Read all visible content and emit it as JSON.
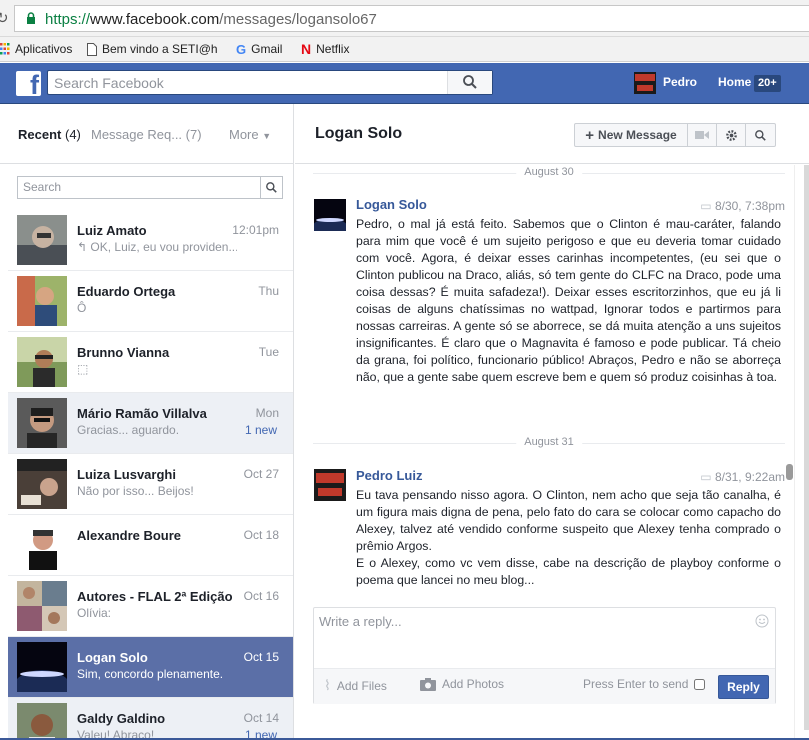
{
  "browser": {
    "url_scheme": "https://",
    "url_domain": "www.facebook.com",
    "url_path": "/messages/logansolo67",
    "bookmarks": [
      {
        "label": "Aplicativos",
        "icon": "apps-grid-icon"
      },
      {
        "label": "Bem vindo a SETI@hc",
        "icon": "page-icon"
      },
      {
        "label": "Gmail",
        "icon": "google-icon"
      },
      {
        "label": "Netflix",
        "icon": "netflix-icon"
      }
    ]
  },
  "topbar": {
    "search_placeholder": "Search Facebook",
    "user_name": "Pedro",
    "home_label": "Home",
    "home_count": "20+",
    "brand_color": "#4267b2"
  },
  "left": {
    "tab_recent": "Recent",
    "tab_recent_count": "(4)",
    "tab_requests": "Message Req...",
    "tab_requests_count": "(7)",
    "tab_more": "More",
    "search_placeholder": "Search",
    "conversations": [
      {
        "name": "Luiz Amato",
        "time": "12:01pm",
        "snippet": "↰ OK, Luiz, eu vou providen...",
        "new": ""
      },
      {
        "name": "Eduardo Ortega",
        "time": "Thu",
        "snippet": "Ô",
        "new": ""
      },
      {
        "name": "Brunno Vianna",
        "time": "Tue",
        "snippet": "⬚",
        "new": ""
      },
      {
        "name": "Mário Ramão Villalva",
        "time": "Mon",
        "snippet": "Gracias... aguardo.",
        "new": "1 new"
      },
      {
        "name": "Luiza Lusvarghi",
        "time": "Oct 27",
        "snippet": "Não por isso... Beijos!",
        "new": ""
      },
      {
        "name": "Alexandre Boure",
        "time": "Oct 18",
        "snippet": "",
        "new": ""
      },
      {
        "name": "Autores - FLAL 2ª Edição",
        "time": "Oct 16",
        "snippet": "Olívia:",
        "new": ""
      },
      {
        "name": "Logan Solo",
        "time": "Oct 15",
        "snippet": "Sim, concordo plenamente.",
        "new": ""
      },
      {
        "name": "Galdy Galdino",
        "time": "Oct 14",
        "snippet": "Valeu! Abraço!",
        "new": "1 new"
      }
    ]
  },
  "thread": {
    "title": "Logan Solo",
    "new_message_label": "New Message",
    "sep1": "August 30",
    "sep2": "August 31",
    "msg1": {
      "sender": "Logan Solo",
      "time": "8/30, 7:38pm",
      "body": "Pedro, o mal já está feito. Sabemos que o Clinton é mau-caráter, falando para mim que você é um sujeito perigoso e que eu deveria tomar cuidado com você. Agora, é deixar esses carinhas incompetentes, (eu sei que o Clinton publicou na Draco, aliás, só tem gente do CLFC na Draco, pode uma coisa dessas? É muita safadeza!). Deixar esses escritorzinhos, que eu já li coisas de alguns chatíssimas no wattpad, Ignorar todos e partirmos para nossas carreiras. A gente só se aborrece, se dá muita atenção a uns sujeitos insignificantes. É claro que o Magnavita é famoso e pode publicar. Tá cheio da grana, foi político, funcionario público! Abraços, Pedro e não se aborreça não, que a gente sabe quem escreve bem e quem só produz coisinhas  à toa."
    },
    "msg2": {
      "sender": "Pedro Luiz",
      "time": "8/31, 9:22am",
      "body": "Eu tava pensando nisso agora. O Clinton, nem acho que seja tão canalha, é um figura mais digna de pena, pelo fato do cara se colocar como capacho do Alexey, talvez até vendido conforme suspeito que Alexey tenha comprado o prêmio Argos.\nE o Alexey, como vc vem disse, cabe na descrição de playboy conforme o poema que lancei no meu blog..."
    },
    "avatar_badge_text": "PEDROOM LANNE"
  },
  "composer": {
    "placeholder": "Write a reply...",
    "add_files": "Add Files",
    "add_photos": "Add Photos",
    "enter_to_send": "Press Enter to send",
    "reply_label": "Reply"
  }
}
